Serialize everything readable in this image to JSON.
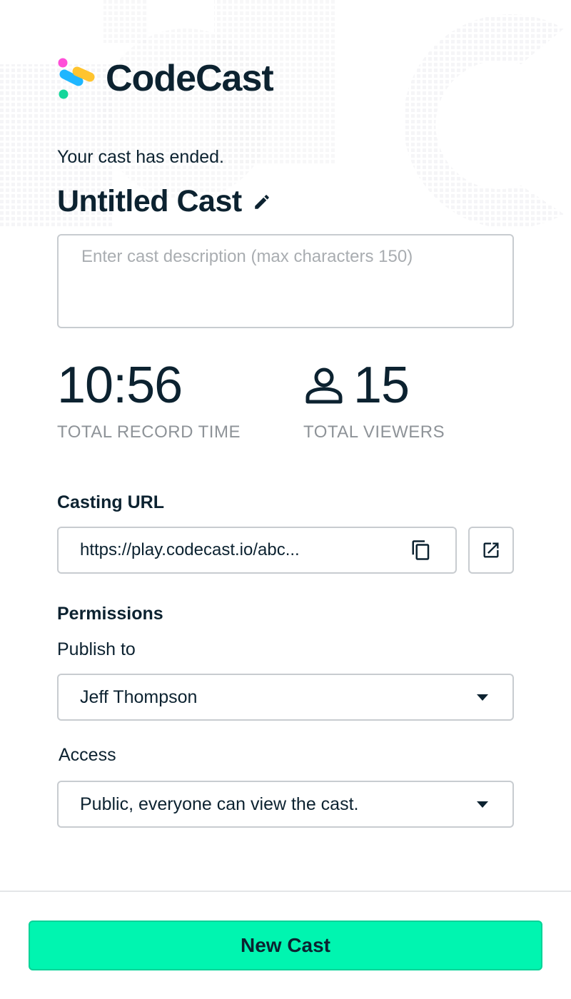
{
  "brand": {
    "name": "CodeCast",
    "colors": {
      "pink": "#ff4fd8",
      "blue": "#1fb6ff",
      "yellow": "#ffc42e",
      "green": "#13d69a",
      "dark": "#0c2230",
      "accent": "#00f5b0"
    }
  },
  "status": {
    "message": "Your cast has ended."
  },
  "cast": {
    "title": "Untitled Cast",
    "edit_icon": "pencil-icon"
  },
  "description": {
    "value": "",
    "placeholder": "Enter cast description (max characters 150)"
  },
  "stats": {
    "record_time": {
      "value": "10:56",
      "label": "TOTAL RECORD TIME"
    },
    "viewers": {
      "value": "15",
      "label": "TOTAL VIEWERS",
      "icon": "user-icon"
    }
  },
  "casting_url": {
    "label": "Casting URL",
    "value": "https://play.codecast.io/abc...",
    "copy_icon": "copy-icon",
    "open_icon": "external-link-icon"
  },
  "permissions": {
    "title": "Permissions",
    "publish_to": {
      "label": "Publish to",
      "selected": "Jeff Thompson"
    },
    "access": {
      "label": "Access",
      "selected": "Public, everyone can view the cast."
    }
  },
  "footer": {
    "new_cast_label": "New Cast"
  }
}
